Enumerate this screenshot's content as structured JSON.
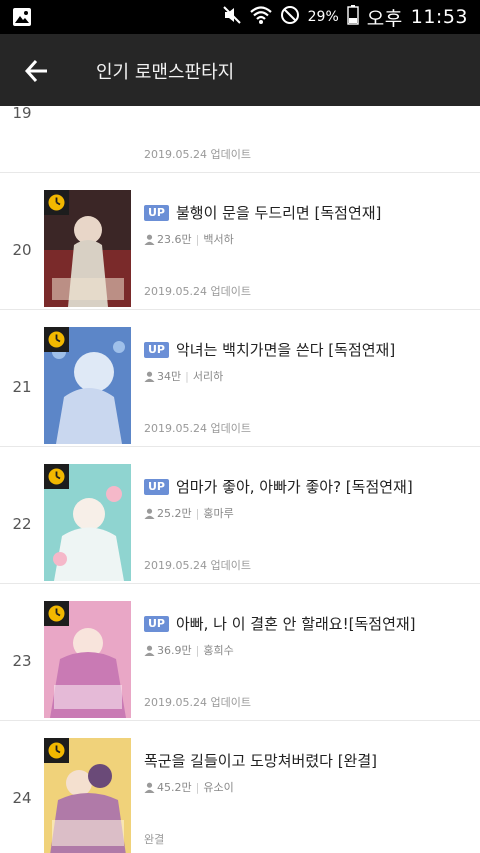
{
  "statusbar": {
    "battery": "29%",
    "ampm": "오후",
    "time": "11:53"
  },
  "appbar": {
    "title": "인기 로맨스판타지"
  },
  "items": [
    {
      "rank": "19",
      "title": "",
      "views": "",
      "author": "",
      "date": "2019.05.24 업데이트",
      "up": false
    },
    {
      "rank": "20",
      "title": "불행이 문을 두드리면 [독점연재]",
      "views": "23.6만",
      "author": "백서하",
      "date": "2019.05.24 업데이트",
      "up": true
    },
    {
      "rank": "21",
      "title": "악녀는 백치가면을 쓴다 [독점연재]",
      "views": "34만",
      "author": "서리하",
      "date": "2019.05.24 업데이트",
      "up": true
    },
    {
      "rank": "22",
      "title": "엄마가 좋아, 아빠가 좋아? [독점연재]",
      "views": "25.2만",
      "author": "홍마루",
      "date": "2019.05.24 업데이트",
      "up": true
    },
    {
      "rank": "23",
      "title": "아빠, 나 이 결혼 안 할래요![독점연재]",
      "views": "36.9만",
      "author": "홍희수",
      "date": "2019.05.24 업데이트",
      "up": true
    },
    {
      "rank": "24",
      "title": "폭군을 길들이고 도망쳐버렸다 [완결]",
      "views": "45.2만",
      "author": "유소이",
      "date": "완결",
      "up": false
    }
  ],
  "labels": {
    "up": "UP"
  },
  "colors": {
    "appbar": "#262626",
    "up_badge": "#6b8fd6",
    "clock_badge": "#f2b800"
  },
  "icons": {
    "back": "arrow-left-icon",
    "clock": "clock-icon",
    "person": "person-icon"
  }
}
